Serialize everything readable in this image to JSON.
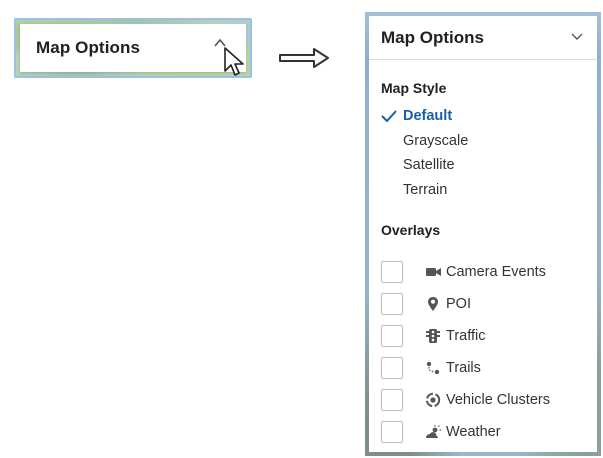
{
  "collapsed": {
    "title": "Map Options",
    "caret_icon": "chevron-up-icon",
    "cursor_icon": "mouse-pointer-icon"
  },
  "transition_icon": "right-arrow-icon",
  "expanded": {
    "title": "Map Options",
    "caret_icon": "chevron-down-icon",
    "map_style": {
      "heading": "Map Style",
      "selected": "Default",
      "options": [
        "Default",
        "Grayscale",
        "Satellite",
        "Terrain"
      ]
    },
    "overlays": {
      "heading": "Overlays",
      "items": [
        {
          "label": "Camera Events",
          "icon": "video-camera-icon",
          "checked": false
        },
        {
          "label": "POI",
          "icon": "map-pin-icon",
          "checked": false
        },
        {
          "label": "Traffic",
          "icon": "traffic-light-icon",
          "checked": false
        },
        {
          "label": "Trails",
          "icon": "trail-route-icon",
          "checked": false
        },
        {
          "label": "Vehicle Clusters",
          "icon": "cluster-icon",
          "checked": false
        },
        {
          "label": "Weather",
          "icon": "weather-icon",
          "checked": false
        }
      ]
    }
  },
  "colors": {
    "selected_text": "#1a5fa3",
    "panel_bg": "#ffffff",
    "map_blue": "#9ab8cc"
  }
}
